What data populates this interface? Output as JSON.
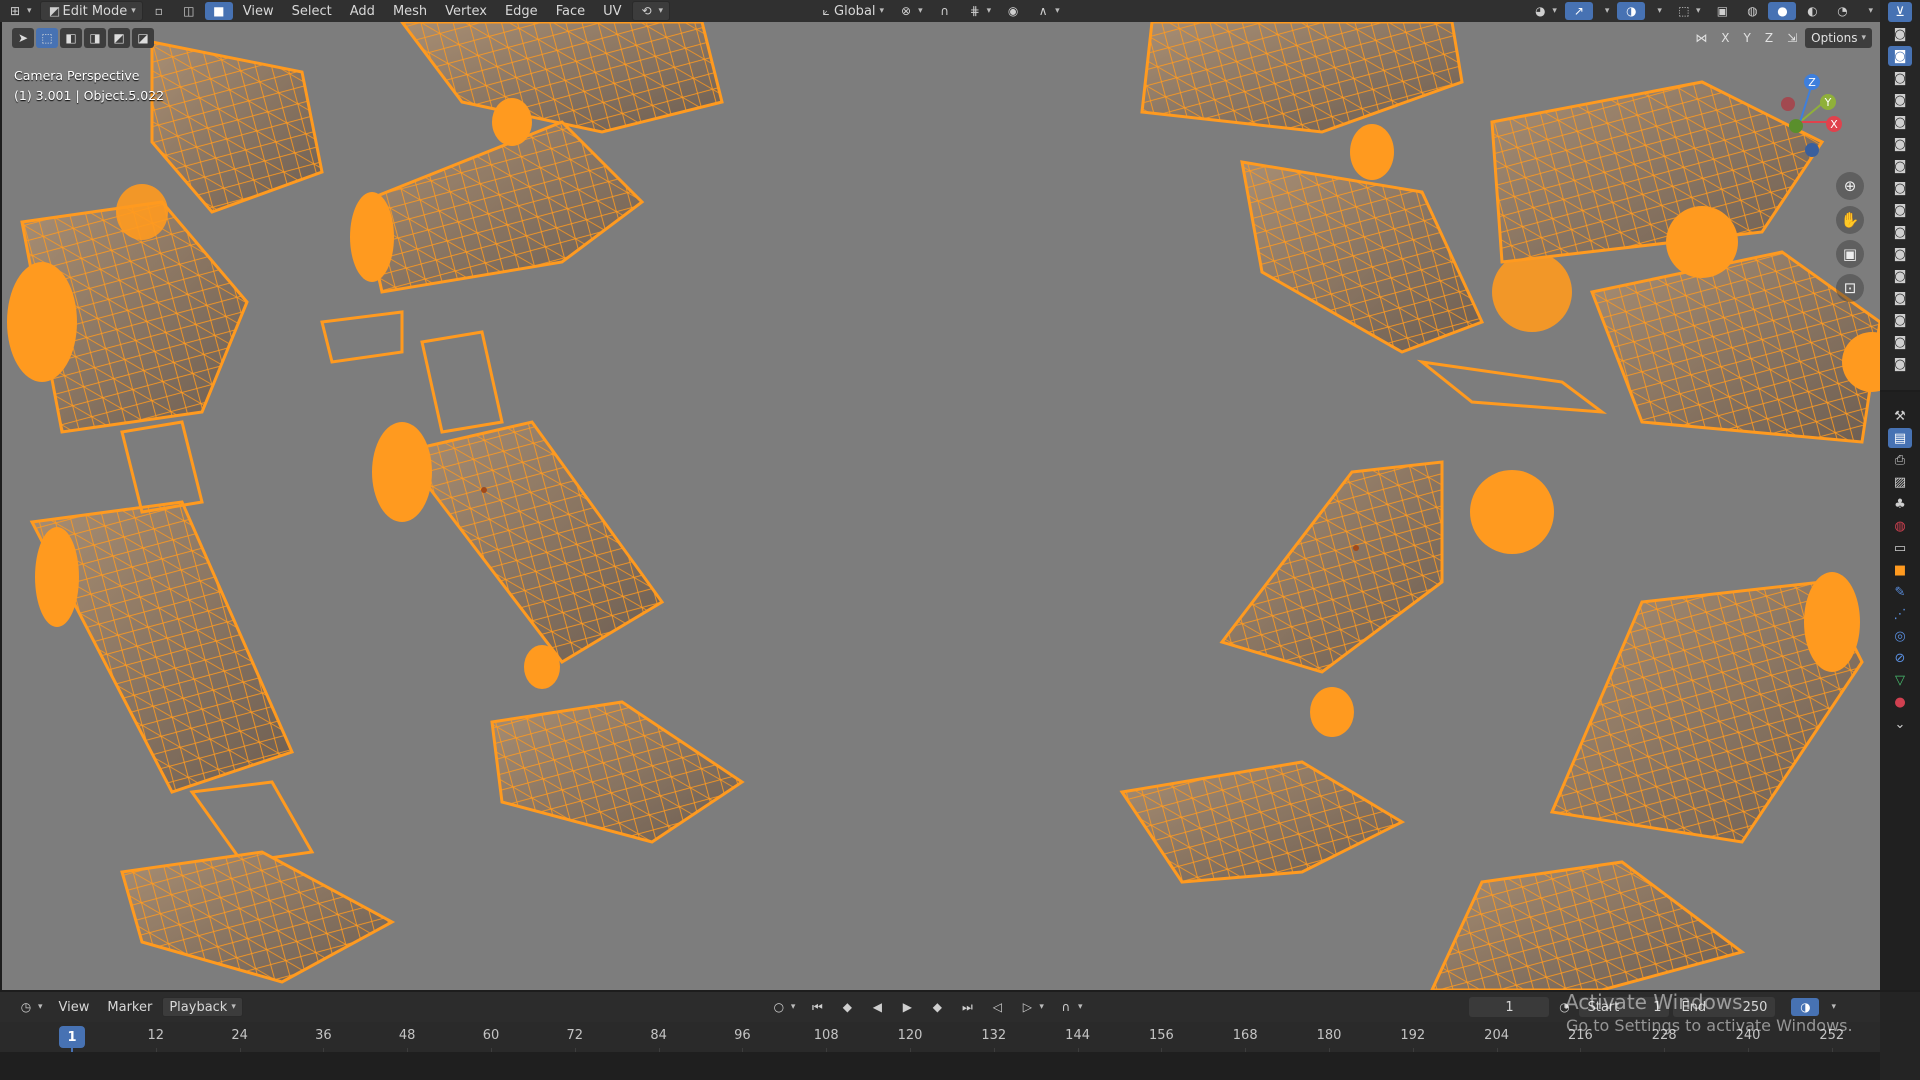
{
  "header": {
    "mode_label": "Edit Mode",
    "menus": [
      "View",
      "Select",
      "Add",
      "Mesh",
      "Vertex",
      "Edge",
      "Face",
      "UV"
    ],
    "orientation_label": "Global"
  },
  "viewport": {
    "info_line1": "Camera Perspective",
    "info_line2": "(1) 3.001 | Object.5.022",
    "axis_x": "X",
    "axis_y": "Y",
    "axis_z": "Z",
    "options_label": "Options",
    "background_color": "#7d7d7d",
    "selection_color": "#ff9a1f"
  },
  "gizmo": {
    "x": "X",
    "y": "Y",
    "z": "Z"
  },
  "timeline": {
    "menus": {
      "view": "View",
      "marker": "Marker",
      "playback": "Playback"
    },
    "current_frame": "1",
    "start_label": "Start",
    "start_value": "1",
    "end_label": "End",
    "end_value": "250",
    "ticks": [
      "1",
      "12",
      "24",
      "36",
      "48",
      "60",
      "72",
      "84",
      "96",
      "108",
      "120",
      "132",
      "144",
      "156",
      "168",
      "180",
      "192",
      "204",
      "216",
      "228",
      "240",
      "252"
    ]
  },
  "watermark": {
    "line1": "Activate Windows",
    "line2": "Go to Settings to activate Windows."
  }
}
